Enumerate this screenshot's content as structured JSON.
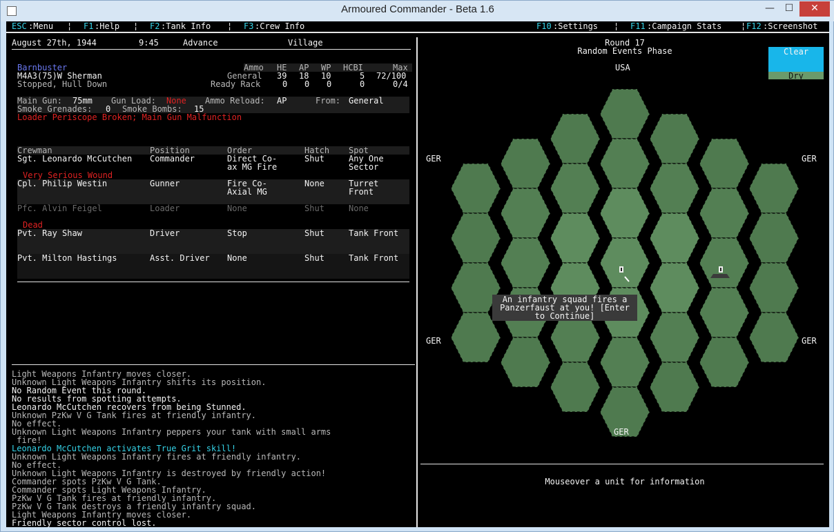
{
  "window": {
    "title": "Armoured Commander - Beta 1.6",
    "close_label": "✕",
    "max_label": "☐",
    "min_label": "—"
  },
  "menu": {
    "esc_key": "ESC",
    "esc_label": ":Menu",
    "f1_key": "F1",
    "f1_label": ":Help",
    "f2_key": "F2",
    "f2_label": ":Tank Info",
    "f3_key": "F3",
    "f3_label": ":Crew Info",
    "f10_key": "F10",
    "f10_label": ":Settings",
    "f11_key": "F11",
    "f11_label": ":Campaign Stats",
    "f12_key": "F12",
    "f12_label": ":Screenshot",
    "sep": "¦"
  },
  "status": {
    "date": "August 27th, 1944",
    "time": "9:45",
    "mission": "Advance",
    "terrain": "Village"
  },
  "tank": {
    "name": "Barnbuster",
    "model": "M4A3(75)W Sherman",
    "state": "Stopped, Hull Down",
    "ammo_headers": [
      "Ammo",
      "HE",
      "AP",
      "WP",
      "HCBI",
      "Max"
    ],
    "ammo_rows": [
      {
        "label": "General",
        "he": "39",
        "ap": "18",
        "wp": "10",
        "hcbi": "5",
        "max": "72/100"
      },
      {
        "label": "Ready Rack",
        "he": "0",
        "ap": "0",
        "wp": "0",
        "hcbi": "0",
        "max": "0/4"
      }
    ],
    "main_gun_label": "Main Gun:",
    "main_gun": "75mm",
    "gun_load_label": "Gun Load:",
    "gun_load": "None",
    "ammo_reload_label": "Ammo Reload:",
    "ammo_reload": "AP",
    "from_label": "From:",
    "from": "General",
    "smoke_grenades_label": "Smoke Grenades:",
    "smoke_grenades": "0",
    "smoke_bombs_label": "Smoke Bombs:",
    "smoke_bombs": "15",
    "damage": "Loader Periscope Broken; Main Gun Malfunction"
  },
  "crew": {
    "headers": [
      "Crewman",
      "Position",
      "Order",
      "Hatch",
      "Spot"
    ],
    "rows": [
      {
        "name": "Sgt. Leonardo McCutchen",
        "position": "Commander",
        "order1": "Direct Co-",
        "order2": "ax MG Fire",
        "hatch": "Shut",
        "spot1": "Any One",
        "spot2": "Sector",
        "status": "Very Serious Wound"
      },
      {
        "name": "Cpl. Philip Westin",
        "position": "Gunner",
        "order1": "Fire Co-",
        "order2": "Axial MG",
        "hatch": "None",
        "spot1": "Turret",
        "spot2": "Front",
        "status": ""
      },
      {
        "name": "Pfc. Alvin Feigel",
        "position": "Loader",
        "order1": "None",
        "order2": "",
        "hatch": "Shut",
        "spot1": "None",
        "spot2": "",
        "status": "Dead"
      },
      {
        "name": "Pvt. Ray Shaw",
        "position": "Driver",
        "order1": "Stop",
        "order2": "",
        "hatch": "Shut",
        "spot1": "Tank Front",
        "spot2": "",
        "status": ""
      },
      {
        "name": "Pvt. Milton Hastings",
        "position": "Asst. Driver",
        "order1": "None",
        "order2": "",
        "hatch": "Shut",
        "spot1": "Tank Front",
        "spot2": "",
        "status": ""
      }
    ]
  },
  "log": [
    {
      "text": "Light Weapons Infantry moves closer.",
      "style": "grey"
    },
    {
      "text": "Unknown Light Weapons Infantry shifts its position.",
      "style": "grey"
    },
    {
      "text": "No Random Event this round.",
      "style": "white"
    },
    {
      "text": "No results from spotting attempts.",
      "style": "white"
    },
    {
      "text": "Leonardo McCutchen recovers from being Stunned.",
      "style": "white"
    },
    {
      "text": "Unknown PzKw V G Tank fires at friendly infantry.",
      "style": "grey"
    },
    {
      "text": "No effect.",
      "style": "grey"
    },
    {
      "text": "Unknown Light Weapons Infantry peppers your tank with small arms",
      "style": "grey"
    },
    {
      "text": " fire!",
      "style": "grey"
    },
    {
      "text": "Leonardo McCutchen activates True Grit skill!",
      "style": "cyan"
    },
    {
      "text": "Unknown Light Weapons Infantry fires at friendly infantry.",
      "style": "grey"
    },
    {
      "text": "No effect.",
      "style": "grey"
    },
    {
      "text": "Unknown Light Weapons Infantry is destroyed by friendly action!",
      "style": "grey"
    },
    {
      "text": "Commander spots PzKw V G Tank.",
      "style": "grey"
    },
    {
      "text": "Commander spots Light Weapons Infantry.",
      "style": "grey"
    },
    {
      "text": "PzKw V G Tank fires at friendly infantry.",
      "style": "grey"
    },
    {
      "text": "PzKw V G Tank destroys a friendly infantry squad.",
      "style": "grey"
    },
    {
      "text": "Light Weapons Infantry moves closer.",
      "style": "grey"
    },
    {
      "text": "Friendly sector control lost.",
      "style": "white"
    }
  ],
  "map": {
    "round": "Round 17",
    "phase": "Random Events Phase",
    "weather_sky": "Clear",
    "weather_ground": "Dry",
    "labels": {
      "top": "USA",
      "bottom": "GER",
      "upper_left": "GER",
      "upper_right": "GER",
      "lower_left": "GER",
      "lower_right": "GER"
    },
    "popup": "An infantry squad fires a\nPanzerfaust at you! [Enter\nto Continue]",
    "info": "Mouseover a unit for information"
  },
  "colors": {
    "accent": "#35d3e8",
    "alert": "#e02222",
    "crew_name": "#6a78f0",
    "hex_outer": "#4f7a4f",
    "hex_inner": "#5d8a5d",
    "sky": "#18b6ea"
  }
}
